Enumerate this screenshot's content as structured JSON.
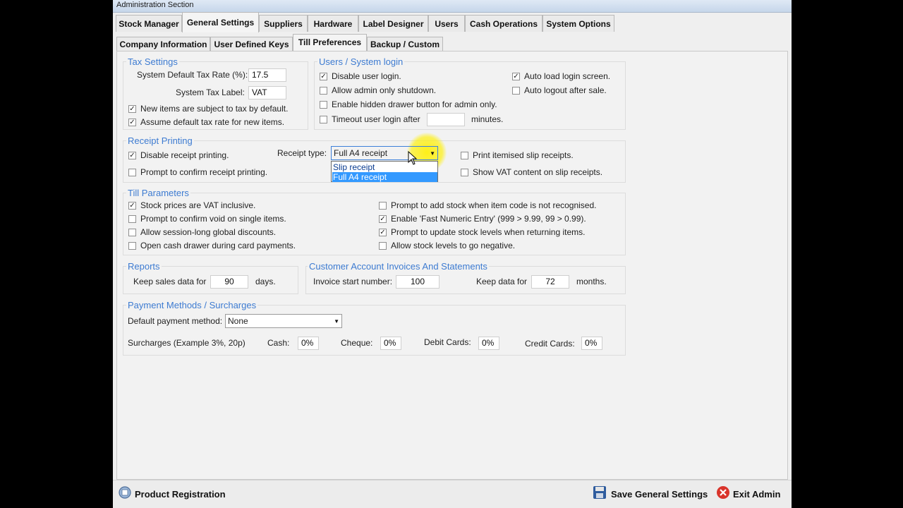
{
  "window": {
    "title": "Administration Section"
  },
  "main_tabs": [
    "Stock Manager",
    "General Settings",
    "Suppliers",
    "Hardware",
    "Label Designer",
    "Users",
    "Cash Operations",
    "System Options"
  ],
  "sub_tabs": [
    "Company Information",
    "User Defined Keys",
    "Till Preferences",
    "Backup / Custom"
  ],
  "tax": {
    "title": "Tax Settings",
    "rate_label": "System Default Tax Rate (%):",
    "rate_value": "17.5",
    "label_label": "System Tax Label:",
    "label_value": "VAT",
    "new_items": "New items are subject to tax by default.",
    "assume_rate": "Assume default tax rate for new items."
  },
  "users": {
    "title": "Users / System login",
    "disable_login": "Disable user login.",
    "admin_shutdown": "Allow admin only shutdown.",
    "hidden_drawer": "Enable hidden drawer button for admin only.",
    "timeout": "Timeout user login after",
    "timeout_units": "minutes.",
    "auto_load": "Auto load login screen.",
    "auto_logout": "Auto logout after sale."
  },
  "receipt": {
    "title": "Receipt Printing",
    "disable": "Disable receipt printing.",
    "prompt": "Prompt to confirm receipt printing.",
    "type_label": "Receipt type:",
    "type_value": "Full A4 receipt",
    "options": [
      "Slip receipt",
      "Full A4 receipt"
    ],
    "print_itemised": "Print itemised slip receipts.",
    "show_vat": "Show VAT content on slip receipts."
  },
  "till": {
    "title": "Till Parameters",
    "vat_inclusive": "Stock prices are VAT inclusive.",
    "confirm_void": "Prompt to confirm void on single items.",
    "global_discounts": "Allow session-long global discounts.",
    "open_drawer": "Open cash drawer during card payments.",
    "add_stock": "Prompt to add stock when item code is not recognised.",
    "fast_numeric": "Enable 'Fast Numeric Entry' (999 > 9.99, 99 > 0.99).",
    "update_stock": "Prompt to update stock levels when returning items.",
    "negative_stock": "Allow stock levels to go negative."
  },
  "reports": {
    "title": "Reports",
    "keep_label": "Keep sales data for",
    "keep_value": "90",
    "keep_units": "days."
  },
  "invoices": {
    "title": "Customer Account Invoices And Statements",
    "start_label": "Invoice start number:",
    "start_value": "100",
    "keep_label": "Keep data for",
    "keep_value": "72",
    "keep_units": "months."
  },
  "payments": {
    "title": "Payment Methods / Surcharges",
    "default_label": "Default payment method:",
    "default_value": "None",
    "surcharges_label": "Surcharges (Example 3%, 20p)",
    "cash_label": "Cash:",
    "cash_value": "0%",
    "cheque_label": "Cheque:",
    "cheque_value": "0%",
    "debit_label": "Debit Cards:",
    "debit_value": "0%",
    "credit_label": "Credit Cards:",
    "credit_value": "0%"
  },
  "footer": {
    "product_registration": "Product Registration",
    "save": "Save General Settings",
    "exit": "Exit Admin"
  },
  "checks": {
    "mark": "✓"
  }
}
